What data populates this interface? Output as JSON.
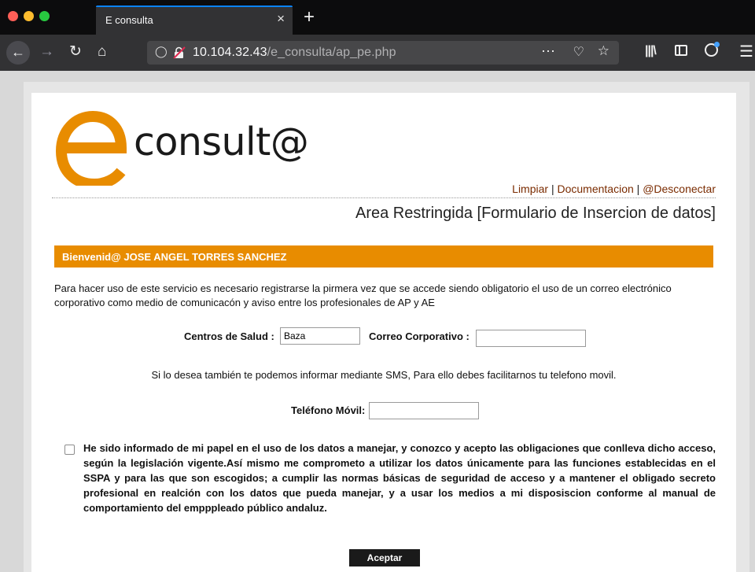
{
  "browser": {
    "tab_title": "E consulta",
    "tab_close": "×",
    "new_tab": "+",
    "url_host": "10.104.32.43",
    "url_path": "/e_consulta/ap_pe.php",
    "icons": [
      "back-arrow-icon",
      "forward-arrow-icon",
      "reload-icon",
      "home-icon",
      "shield-icon",
      "insecure-lock-icon",
      "page-actions-icon",
      "pocket-icon",
      "bookmark-star-icon",
      "library-icon",
      "sidebar-icon",
      "account-icon",
      "menu-icon"
    ]
  },
  "logo": {
    "text": "consult@",
    "accent_color": "#e88c00"
  },
  "links": {
    "limpiar": "Limpiar",
    "documentacion": "Documentacion",
    "desconectar": "@Desconectar",
    "separator": "|"
  },
  "area_title": "Area Restringida [Formulario de Insercion de datos]",
  "welcome": "Bienvenid@ JOSE ANGEL TORRES SANCHEZ",
  "intro": "Para hacer uso de este servicio es necesario registrarse la pirmera vez que se accede siendo obligatorio el uso de un correo electrónico corporativo como medio de comunicacón y aviso entre los profesionales de AP y AE",
  "form": {
    "centros_label": "Centros de Salud :",
    "centros_value": "Baza",
    "correo_label": "Correo Corporativo :",
    "correo_value": "",
    "sms_text": "Si lo desea también te podemos informar mediante SMS, Para ello debes facilitarnos tu telefono movil.",
    "movil_label": "Teléfono Móvil:",
    "movil_value": "",
    "consent_checked": false,
    "consent_text": "He sido informado de mi papel en el uso de los datos a manejar, y conozco y acepto las obligaciones que conlleva dicho acceso, según la legislación vigente.Así mismo me comprometo a utilizar los datos únicamente para las funciones establecidas en el SSPA y para las que son escogidos; a cumplir las normas básicas de seguridad de acceso y a mantener el obligado secreto profesional en realción con los datos que pueda manejar, y a usar los medios a mi disposiscion conforme al manual de comportamiento del empppleado público andaluz.",
    "submit_label": "Aceptar"
  }
}
